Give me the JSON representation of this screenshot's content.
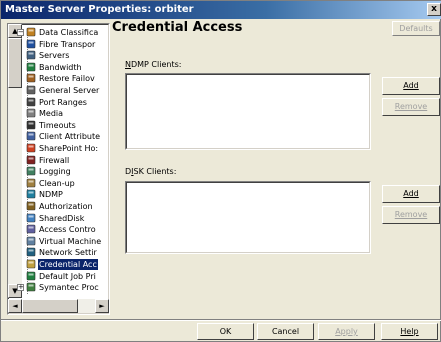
{
  "window": {
    "title": "Master Server Properties: orbiter",
    "close_label": "x"
  },
  "tree": {
    "items": [
      {
        "label": "Data Classifica",
        "icon": "data-classification-icon"
      },
      {
        "label": "Fibre Transpor",
        "icon": "fibre-transport-icon"
      },
      {
        "label": "Servers",
        "icon": "servers-icon"
      },
      {
        "label": "Bandwidth",
        "icon": "bandwidth-icon"
      },
      {
        "label": "Restore Failov",
        "icon": "restore-failover-icon"
      },
      {
        "label": "General Server",
        "icon": "general-server-icon"
      },
      {
        "label": "Port Ranges",
        "icon": "port-ranges-icon"
      },
      {
        "label": "Media",
        "icon": "media-icon"
      },
      {
        "label": "Timeouts",
        "icon": "timeouts-icon"
      },
      {
        "label": "Client Attribute",
        "icon": "client-attributes-icon"
      },
      {
        "label": "SharePoint Ho:",
        "icon": "sharepoint-icon"
      },
      {
        "label": "Firewall",
        "icon": "firewall-icon"
      },
      {
        "label": "Logging",
        "icon": "logging-icon"
      },
      {
        "label": "Clean-up",
        "icon": "clean-up-icon"
      },
      {
        "label": "NDMP",
        "icon": "ndmp-icon"
      },
      {
        "label": "Authorization",
        "icon": "authorization-icon"
      },
      {
        "label": "SharedDisk",
        "icon": "shared-disk-icon"
      },
      {
        "label": "Access Contro",
        "icon": "access-control-icon"
      },
      {
        "label": "Virtual Machine",
        "icon": "virtual-machine-icon"
      },
      {
        "label": "Network Settir",
        "icon": "network-settings-icon"
      },
      {
        "label": "Credential Acc",
        "icon": "credential-access-icon",
        "selected": true
      },
      {
        "label": "Default Job Pri",
        "icon": "default-job-priority-icon"
      },
      {
        "label": "Symantec Proc",
        "icon": "symantec-products-icon"
      }
    ]
  },
  "main": {
    "heading": "Credential Access",
    "defaults_label": "Defaults",
    "ndmp": {
      "label_prefix": "",
      "label_underlined": "N",
      "label_rest": "DMP Clients:",
      "add_label": "Add",
      "remove_label": "Remove"
    },
    "disk": {
      "label_prefix": "D",
      "label_underlined": "I",
      "label_rest": "SK Clients:",
      "add_label": "Add",
      "remove_label": "Remove"
    }
  },
  "footer": {
    "ok_label": "OK",
    "cancel_label": "Cancel",
    "apply_label": "Apply",
    "help_label": "Help"
  },
  "colors": {
    "title_bar": "#0a246a",
    "selection": "#0a246a",
    "dialog_bg": "#ece9d8"
  }
}
